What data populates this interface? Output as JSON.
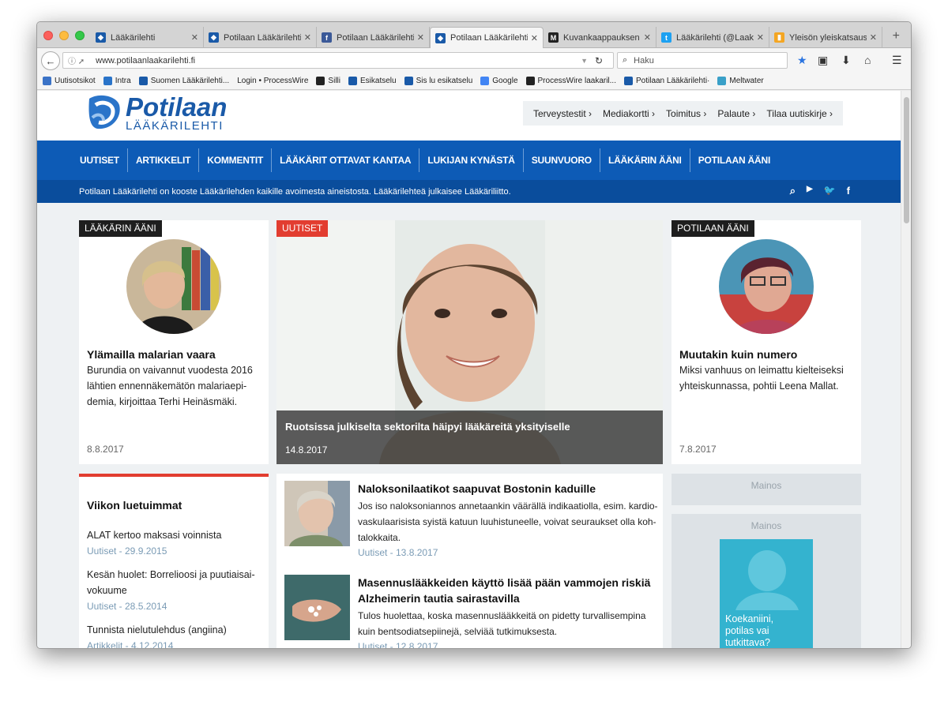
{
  "browser": {
    "tabs": [
      {
        "label": "Lääkärilehti",
        "favicon": "laakarilehti-icon",
        "active": false
      },
      {
        "label": "Potilaan Lääkärilehti",
        "favicon": "laakarilehti-icon",
        "active": false
      },
      {
        "label": "Potilaan Lääkärilehti -",
        "favicon": "facebook-icon",
        "active": false
      },
      {
        "label": "Potilaan Lääkärilehti",
        "favicon": "laakarilehti-icon",
        "active": true
      },
      {
        "label": "Kuvankaappauksen o",
        "favicon": "mk-icon",
        "active": false
      },
      {
        "label": "Lääkärilehti (@Laakar",
        "favicon": "twitter-icon",
        "active": false
      },
      {
        "label": "Yleisön yleiskatsaus -",
        "favicon": "analytics-icon",
        "active": false
      }
    ],
    "url": "www.potilaanlaakarilehti.fi",
    "search_placeholder": "Haku",
    "bookmarks": [
      {
        "label": "Uutisotsikot",
        "color": "#3b73c7"
      },
      {
        "label": "Intra",
        "color": "#2a74c9"
      },
      {
        "label": "Suomen Lääkärilehti...",
        "color": "#1a5aa8"
      },
      {
        "label": "Login • ProcessWire",
        "color": "#555555"
      },
      {
        "label": "Silli",
        "color": "#222222"
      },
      {
        "label": "Esikatselu",
        "color": "#1a5aa8"
      },
      {
        "label": "Sis lu esikatselu",
        "color": "#1a5aa8"
      },
      {
        "label": "Google",
        "color": "#4285f4"
      },
      {
        "label": "ProcessWire laakaril...",
        "color": "#222222"
      },
      {
        "label": "Potilaan Lääkärilehti·",
        "color": "#1a5aa8"
      },
      {
        "label": "Meltwater",
        "color": "#3aa0c8"
      }
    ]
  },
  "site": {
    "logo_main": "Potilaan",
    "logo_sub": "LÄÄKÄRILEHTI",
    "top_links": [
      "Terveystestit ›",
      "Mediakortti ›",
      "Toimitus ›",
      "Palaute ›",
      "Tilaa uutiskirje ›"
    ],
    "nav": [
      "UUTISET",
      "ARTIKKELIT",
      "KOMMENTIT",
      "LÄÄKÄRIT OTTAVAT KANTAA",
      "LUKIJAN KYNÄSTÄ",
      "SUUNVUORO",
      "LÄÄKÄRIN ÄÄNI",
      "POTILAAN ÄÄNI"
    ],
    "tagline": "Potilaan Lääkärilehti on kooste Lääkärilehden kaikille avoimesta aineistosta. Lääkärilehteä julkaisee Lääkäriliitto."
  },
  "left_card": {
    "tag": "LÄÄKÄRIN ÄÄNI",
    "title": "Ylämailla malarian vaara",
    "text_lines": [
      "Burundia on vaivannut vuodesta 2016",
      "lähtien ennennäkemätön malariaepi-",
      "demia, kirjoittaa Terhi Heinäsmäki."
    ],
    "date": "8.8.2017"
  },
  "hero": {
    "tag": "UUTISET",
    "title": "Ruotsissa julkiselta sektorilta häipyi lääkäreitä yksityiselle",
    "date": "14.8.2017"
  },
  "right_card": {
    "tag": "POTILAAN ÄÄNI",
    "title": "Muutakin kuin numero",
    "text_lines": [
      "Miksi vanhuus on leimattu kielteiseksi",
      "yhteiskunnassa, pohtii Leena Mallat."
    ],
    "date": "7.8.2017"
  },
  "popular": {
    "title": "Viikon luetuimmat",
    "items": [
      {
        "title": "ALAT kertoo maksasi voinnista",
        "meta": "Uutiset - 29.9.2015"
      },
      {
        "title": "Kesän huolet: Borrelioosi ja puutiaisai-vokuume",
        "meta": "Uutiset - 28.5.2014"
      },
      {
        "title": "Tunnista nielutulehdus (angiina)",
        "meta": "Artikkelit - 4.12.2014"
      }
    ]
  },
  "news": [
    {
      "title": "Naloksonilaatikot saapuvat Bostonin kaduille",
      "text": "Jos iso naloksoniannos annetaankin väärällä indikaatiolla, esim. kardio-vaskulaarisista syistä katuun luuhistuneelle, voivat seuraukset olla koh-talokkaita.",
      "meta": "Uutiset - 13.8.2017"
    },
    {
      "title": "Masennuslääkkeiden käyttö lisää pään vammojen riskiä Alzheimerin tautia sairastavilla",
      "text": "Tulos huolettaa, koska masennuslääkkeitä on pidetty turvallisempina kuin bentsodiatsepiinejä, selviää tutkimuksesta.",
      "meta": "Uutiset - 12.8.2017"
    }
  ],
  "ads": {
    "label1": "Mainos",
    "label2": "Mainos",
    "banner_text_1": "Koekaniini,",
    "banner_text_2": "potilas vai",
    "banner_text_3": "tutkittava?"
  }
}
